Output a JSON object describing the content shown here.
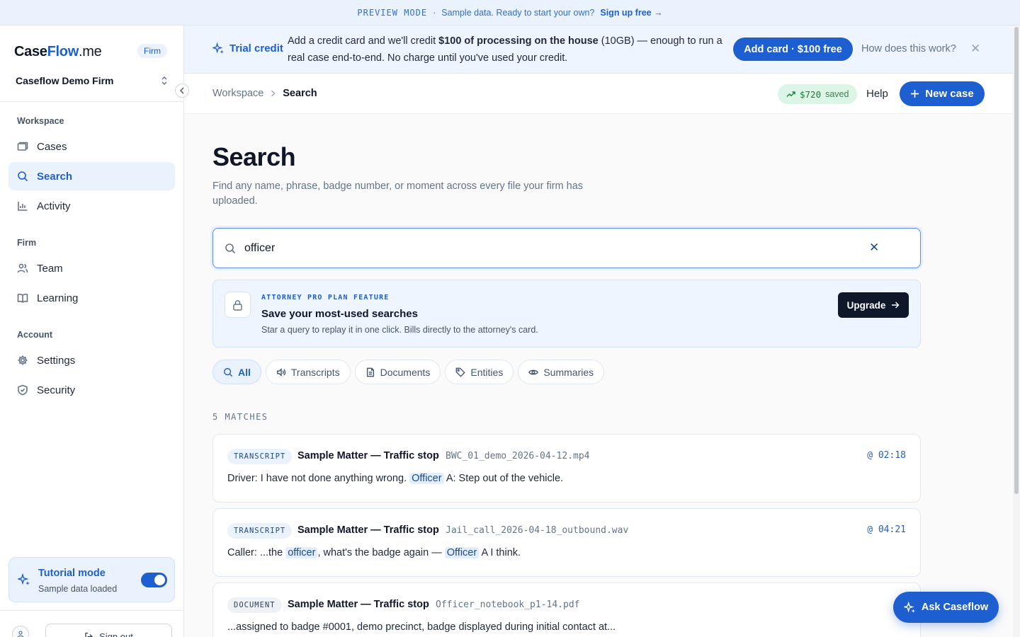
{
  "preview": {
    "mode": "PREVIEW MODE",
    "separator": "·",
    "message": "Sample data. Ready to start your own?",
    "signup": "Sign up free →"
  },
  "sidebar": {
    "brand": {
      "case": "Case",
      "flow": "Flow",
      "me": ".me"
    },
    "firm_badge": "Firm",
    "firm_name": "Caseflow Demo Firm",
    "sections": {
      "workspace": "Workspace",
      "firm": "Firm",
      "account": "Account"
    },
    "items": [
      {
        "label": "Cases",
        "icon": "cases-icon"
      },
      {
        "label": "Search",
        "icon": "search-icon",
        "active": true
      },
      {
        "label": "Activity",
        "icon": "activity-icon"
      },
      {
        "label": "Team",
        "icon": "team-icon"
      },
      {
        "label": "Learning",
        "icon": "book-icon"
      },
      {
        "label": "Settings",
        "icon": "gear-icon"
      },
      {
        "label": "Security",
        "icon": "shield-icon"
      }
    ],
    "tutorial": {
      "title": "Tutorial mode",
      "subtitle": "Sample data loaded",
      "enabled": true
    },
    "signout": "Sign out"
  },
  "trial": {
    "label": "Trial credit",
    "message_before": "Add a credit card and we'll credit",
    "message_bold": "$100 of processing on the house",
    "message_after": "(10GB) — enough to run a real case end-to-end. No charge until you've used your credit.",
    "cta": "Add card · $100 free",
    "how": "How does this work?",
    "close": "✕"
  },
  "topbar": {
    "breadcrumb": [
      "Workspace",
      "Search"
    ],
    "saved_amount": "$720",
    "saved_label": "saved",
    "help": "Help",
    "new_case": "New case"
  },
  "main": {
    "title": "Search",
    "subtitle": "Find any name, phrase, badge number, or moment across every file your firm has uploaded.",
    "search": {
      "value": "officer",
      "clear": "✕"
    },
    "upsell": {
      "kicker": "ATTORNEY PRO PLAN FEATURE",
      "title": "Save your most-used searches",
      "subtitle": "Star a query to replay it in one click. Bills directly to the attorney's card.",
      "button": "Upgrade"
    },
    "filters": [
      {
        "label": "All",
        "icon": "search-icon",
        "active": true
      },
      {
        "label": "Transcripts",
        "icon": "audio-icon"
      },
      {
        "label": "Documents",
        "icon": "document-icon"
      },
      {
        "label": "Entities",
        "icon": "tag-icon"
      },
      {
        "label": "Summaries",
        "icon": "eye-icon"
      }
    ],
    "matches_label": "5 MATCHES",
    "results": [
      {
        "tag": "TRANSCRIPT",
        "matter": "Sample Matter — Traffic stop",
        "separator": "·",
        "file": "BWC_01_demo_2026-04-12.mp4",
        "time": "@ 02:18",
        "snippet": {
          "p1": "Driver: I have not done anything wrong.",
          "h1": "Officer",
          "p2": "A: Step out of the vehicle."
        }
      },
      {
        "tag": "TRANSCRIPT",
        "matter": "Sample Matter — Traffic stop",
        "separator": "·",
        "file": "Jail_call_2026-04-18_outbound.wav",
        "time": "@ 04:21",
        "snippet": {
          "p1": "Caller: ...the",
          "h1": "officer",
          "p2": ", what's the badge again —",
          "h2": "Officer",
          "p3": "A I think."
        }
      },
      {
        "tag": "DOCUMENT",
        "matter": "Sample Matter — Traffic stop",
        "separator": "·",
        "file": "Officer_notebook_p1-14.pdf",
        "snippet": {
          "p1": "...assigned to badge #0001, demo precinct, badge displayed during initial contact at..."
        }
      }
    ]
  },
  "ask": "Ask Caseflow",
  "colors": {
    "accent": "#1d5fd0",
    "saved_bg": "#dcf5e6",
    "dark_button": "#0f172a"
  }
}
